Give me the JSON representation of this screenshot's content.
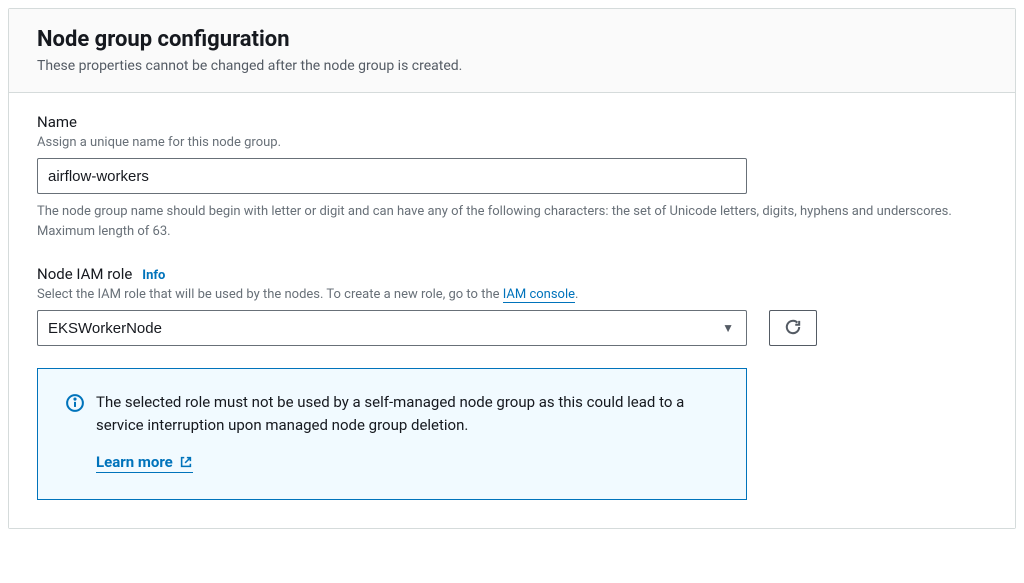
{
  "header": {
    "title": "Node group configuration",
    "subtitle": "These properties cannot be changed after the node group is created."
  },
  "nameField": {
    "label": "Name",
    "description": "Assign a unique name for this node group.",
    "value": "airflow-workers",
    "hint": "The node group name should begin with letter or digit and can have any of the following characters: the set of Unicode letters, digits, hyphens and underscores. Maximum length of 63."
  },
  "iamRoleField": {
    "label": "Node IAM role",
    "infoLabel": "Info",
    "descriptionPrefix": "Select the IAM role that will be used by the nodes. To create a new role, go to the ",
    "iamConsoleLink": "IAM console",
    "descriptionSuffix": ".",
    "value": "EKSWorkerNode"
  },
  "infoBox": {
    "text": "The selected role must not be used by a self-managed node group as this could lead to a service interruption upon managed node group deletion.",
    "learnMore": "Learn more"
  }
}
